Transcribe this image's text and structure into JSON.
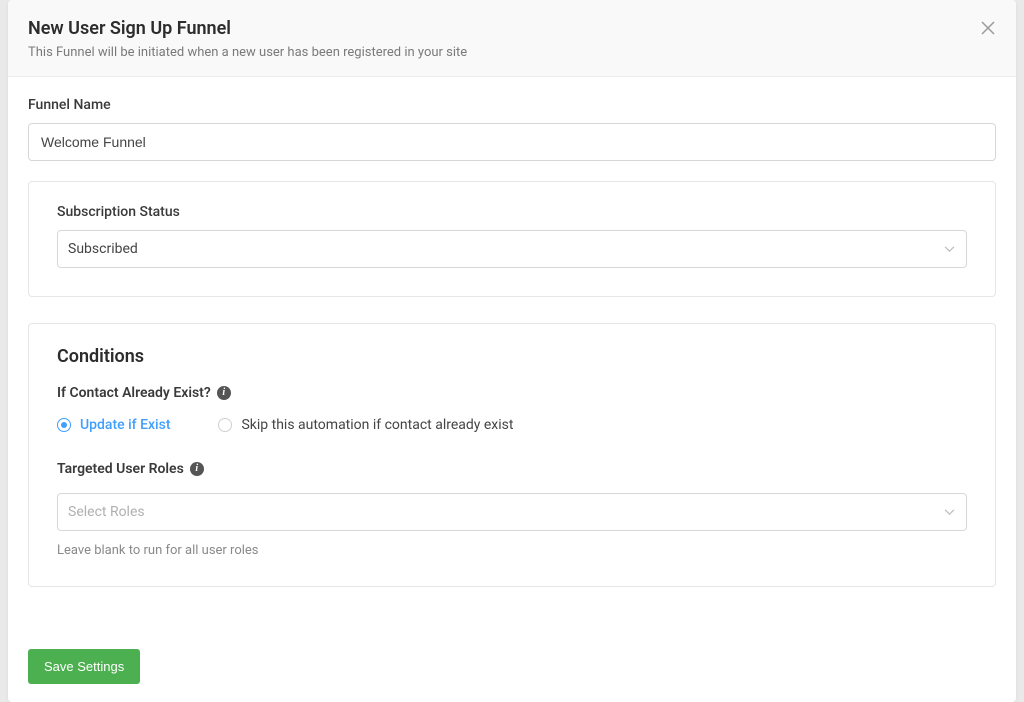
{
  "header": {
    "title": "New User Sign Up Funnel",
    "subtitle": "This Funnel will be initiated when a new user has been registered in your site"
  },
  "funnel_name": {
    "label": "Funnel Name",
    "value": "Welcome Funnel"
  },
  "subscription": {
    "label": "Subscription Status",
    "value": "Subscribed"
  },
  "conditions": {
    "title": "Conditions",
    "exist_label": "If Contact Already Exist?",
    "options": {
      "update": "Update if Exist",
      "skip": "Skip this automation if contact already exist"
    },
    "selected": "update",
    "roles_label": "Targeted User Roles",
    "roles_placeholder": "Select Roles",
    "roles_help": "Leave blank to run for all user roles"
  },
  "footer": {
    "save_label": "Save Settings"
  }
}
